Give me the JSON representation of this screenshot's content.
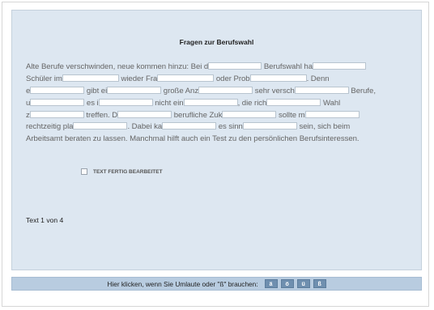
{
  "title": "Fragen zur Berufswahl",
  "cloze": {
    "l1": [
      "Alte Berufe verschwinden, neue kommen hinzu: Bei d",
      " Berufswahl ha"
    ],
    "l2": [
      "Schüler im",
      " wieder Fra",
      " oder Prob",
      ". Denn"
    ],
    "l3": [
      "e",
      " gibt ei",
      " große Anz",
      " sehr versch",
      " Berufe,"
    ],
    "l4": [
      "u",
      " es i",
      " nicht ein",
      ", die rich",
      " Wahl"
    ],
    "l5": [
      "z",
      " treffen. D",
      " berufliche Zuk",
      " sollte m"
    ],
    "l6": [
      "rechtzeitig pla",
      ". Dabei ka",
      " es sinn",
      " sein, sich beim"
    ],
    "l7": "Arbeitsamt beraten zu lassen. Manchmal hilft auch ein Test zu den persönlichen Berufsinteressen."
  },
  "checkbox_label": "TEXT FERTIG BEARBEITET",
  "pager": "Text 1 von 4",
  "umlaut_bar": {
    "label": "Hier klicken, wenn Sie Umlaute oder \"ß\" brauchen:",
    "buttons": [
      "ä",
      "ö",
      "ü",
      "ß"
    ]
  }
}
